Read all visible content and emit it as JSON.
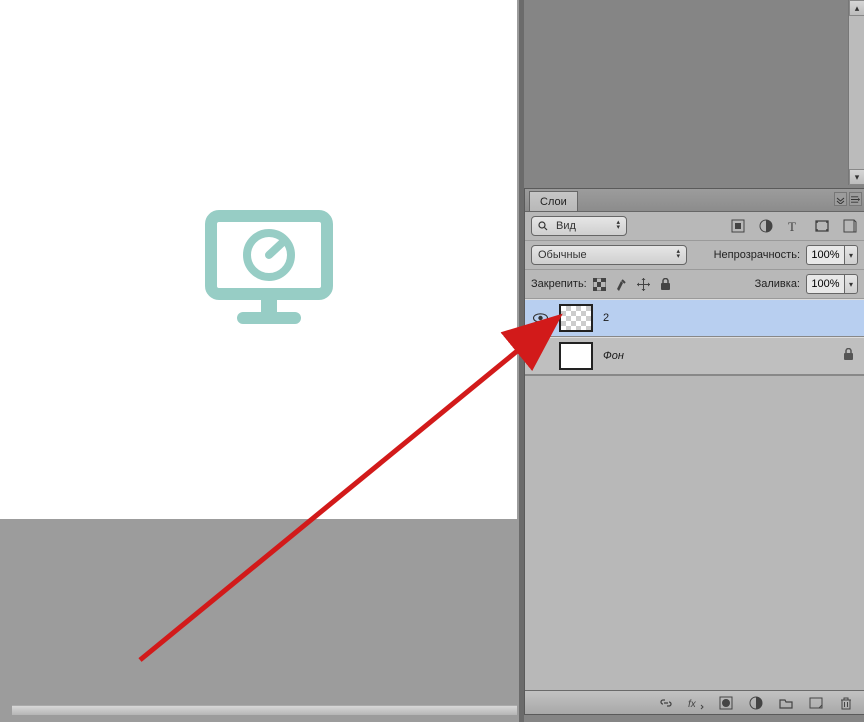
{
  "panel_title": "Слои",
  "filter_label": "Вид",
  "blend_mode": "Обычные",
  "opacity_label": "Непрозрачность:",
  "opacity_value": "100%",
  "lock_label": "Закрепить:",
  "fill_label": "Заливка:",
  "fill_value": "100%",
  "layers": {
    "0": {
      "name": "2"
    },
    "1": {
      "name": "Фон"
    }
  },
  "colors": {
    "canvas_icon": "#97cdc5"
  }
}
